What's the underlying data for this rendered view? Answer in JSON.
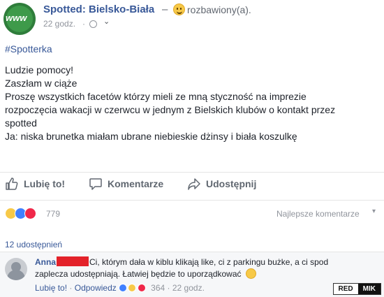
{
  "post": {
    "page_name": "Spotted: Bielsko-Biała",
    "dash": "–",
    "feeling": "rozbawiony(a).",
    "timestamp": "22 godz.",
    "separator": "·",
    "hashtag": "#Spotterka",
    "lines": [
      "Ludzie pomocy!",
      "Zaszłam w ciąże",
      "Proszę wszystkich facetów którzy mieli ze mną styczność na imprezie",
      "rozpoczęcia wakacji w czerwcu w jednym z Bielskich klubów o kontakt przez",
      "spotted",
      "Ja: niska brunetka miałam ubrane niebieskie dżinsy i biała koszulkę"
    ]
  },
  "actions": {
    "like": "Lubię to!",
    "comment": "Komentarze",
    "share": "Udostępnij"
  },
  "reactions": {
    "count": "779",
    "sort": "Najlepsze komentarze"
  },
  "shares": "12 udostępnień",
  "comment": {
    "name": "Anna",
    "text_a": "Ci, którym dała w kiblu klikają like, ci z parkingu bużke, a ci spod",
    "text_b": "zaplecza udostępniają. Łatwiej będzie to uporządkować",
    "like": "Lubię to!",
    "reply": "Odpowiedz",
    "reaction_count": "364",
    "time": "22 godz."
  },
  "watermark": {
    "left": "RED",
    "right": "MIK"
  },
  "colors": {
    "link": "#385898",
    "muted": "#90949c",
    "redaction": "#e3222a"
  }
}
